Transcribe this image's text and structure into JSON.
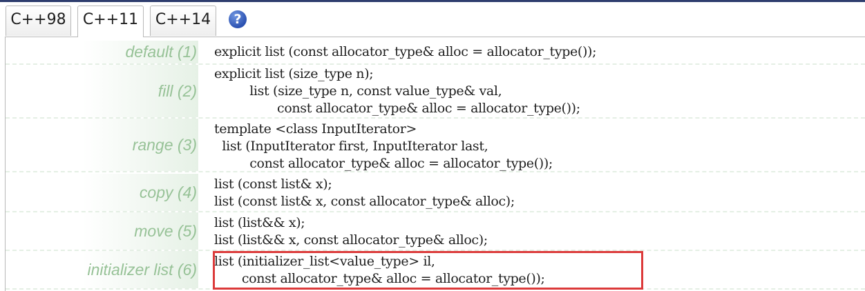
{
  "tabs": [
    {
      "label": "C++98",
      "active": false
    },
    {
      "label": "C++11",
      "active": true
    },
    {
      "label": "C++14",
      "active": false
    }
  ],
  "help": {
    "glyph": "?"
  },
  "constructors": [
    {
      "label": "default (1)",
      "code": "explicit list (const allocator_type& alloc = allocator_type());"
    },
    {
      "label": "fill (2)",
      "code": "explicit list (size_type n);\n         list (size_type n, const value_type& val,\n                const allocator_type& alloc = allocator_type());"
    },
    {
      "label": "range (3)",
      "code": "template <class InputIterator>\n  list (InputIterator first, InputIterator last,\n         const allocator_type& alloc = allocator_type());"
    },
    {
      "label": "copy (4)",
      "code": "list (const list& x);\nlist (const list& x, const allocator_type& alloc);"
    },
    {
      "label": "move (5)",
      "code": "list (list&& x);\nlist (list&& x, const allocator_type& alloc);"
    },
    {
      "label": "initializer list (6)",
      "code": "list (initializer_list<value_type> il,\n       const allocator_type& alloc = allocator_type());"
    }
  ],
  "colors": {
    "label_text": "#97c297",
    "label_gradient": "#e6f1e6",
    "highlight_border": "#dc3a3a",
    "top_border": "#2e3d6e",
    "help_icon": "#2c52b2"
  },
  "highlighted_row": 5
}
